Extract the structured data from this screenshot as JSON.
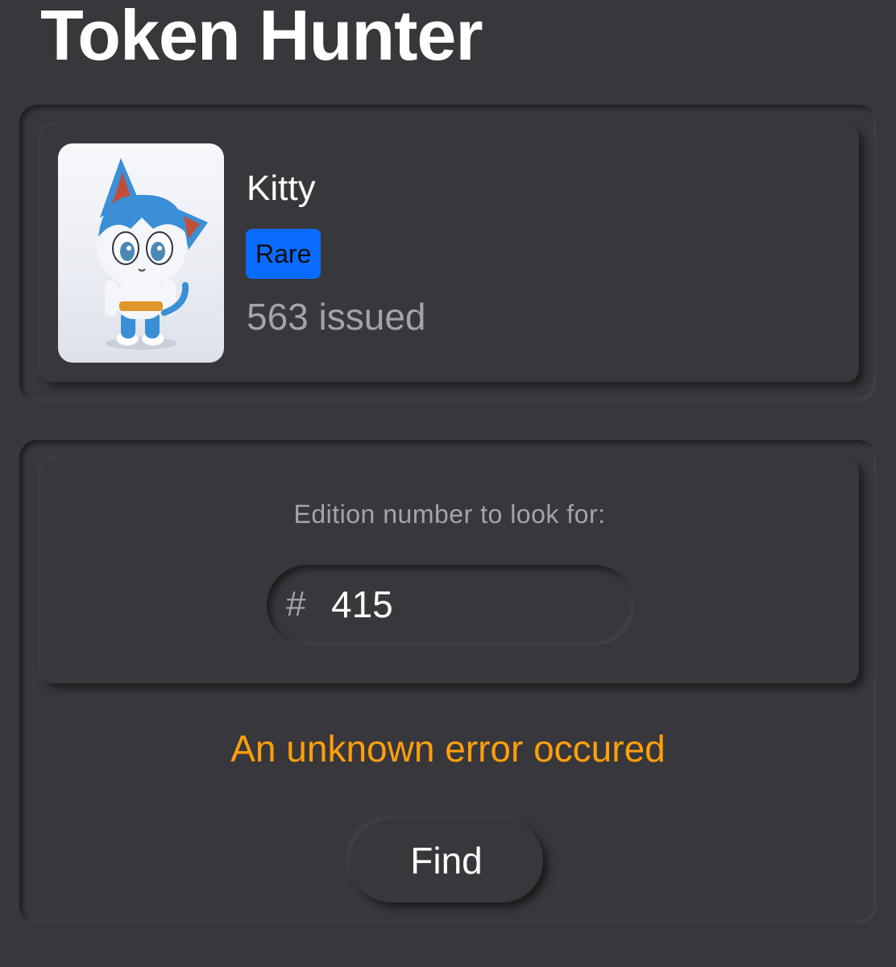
{
  "app": {
    "title": "Token Hunter"
  },
  "token": {
    "name": "Kitty",
    "rarity": "Rare",
    "issued": "563 issued",
    "image": "kitty-character-illustration",
    "rarity_color": "#0a6cff"
  },
  "search": {
    "label": "Edition number to look for:",
    "prefix": "#",
    "value": "415"
  },
  "status": {
    "error": "An unknown error occured",
    "error_color": "#ff9f0a"
  },
  "actions": {
    "find_label": "Find"
  }
}
